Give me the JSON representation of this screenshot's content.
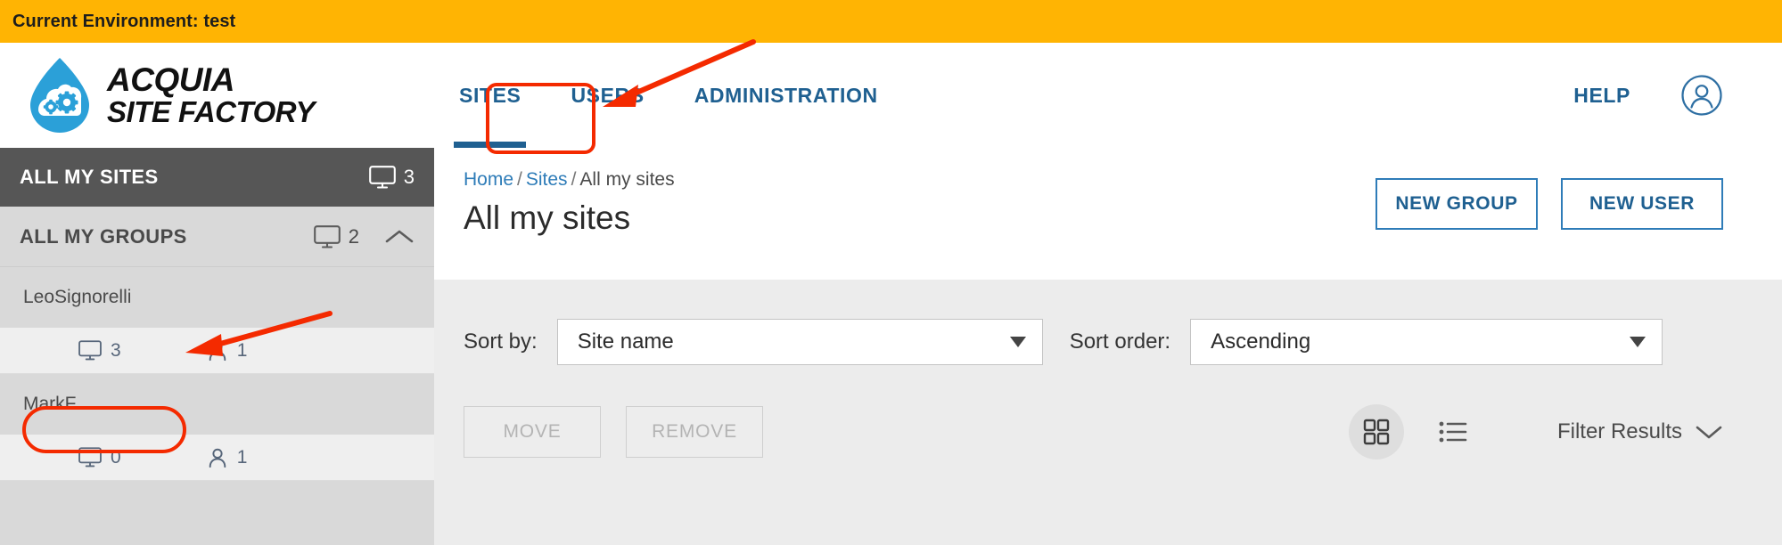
{
  "env_banner": {
    "text": "Current Environment: test",
    "bg": "#FFB403"
  },
  "brand": {
    "line1": "ACQUIA",
    "line2": "SITE FACTORY",
    "droplet_color": "#2BA0D8",
    "logo_icon": "acquia-droplet-gears-logo"
  },
  "nav": {
    "tabs": [
      {
        "label": "SITES",
        "active": true
      },
      {
        "label": "USERS",
        "active": false
      },
      {
        "label": "ADMINISTRATION",
        "active": false
      }
    ],
    "help_label": "HELP",
    "avatar_icon": "user-circle-icon",
    "link_color": "#1F6091"
  },
  "sidebar": {
    "all_sites": {
      "label": "ALL MY SITES",
      "count": "3",
      "icon": "monitor-icon",
      "bg": "#565656"
    },
    "all_groups": {
      "label": "ALL MY GROUPS",
      "count": "2",
      "icon": "monitor-icon",
      "chevron": "chevron-up-icon"
    },
    "groups": [
      {
        "name": "LeoSignorelli",
        "sites": "3",
        "users": "1"
      },
      {
        "name": "MarkF",
        "sites": "0",
        "users": "1"
      }
    ]
  },
  "main": {
    "breadcrumb": {
      "home": "Home",
      "sites": "Sites",
      "current": "All my sites",
      "separator": "/"
    },
    "title": "All my sites",
    "buttons": {
      "new_group": "NEW GROUP",
      "new_user": "NEW USER"
    },
    "controls": {
      "sort_by_label": "Sort by:",
      "sort_by_value": "Site name",
      "sort_order_label": "Sort order:",
      "sort_order_value": "Ascending",
      "move_label": "MOVE",
      "remove_label": "REMOVE",
      "filter_label": "Filter Results",
      "grid_view_icon": "grid-view-icon",
      "list_view_icon": "list-view-icon",
      "filter_chevron_icon": "chevron-down-icon"
    }
  },
  "annotations": {
    "color": "#F42A00",
    "highlight_sites_tab": "SITES",
    "highlight_group": "LeoSignorelli"
  }
}
